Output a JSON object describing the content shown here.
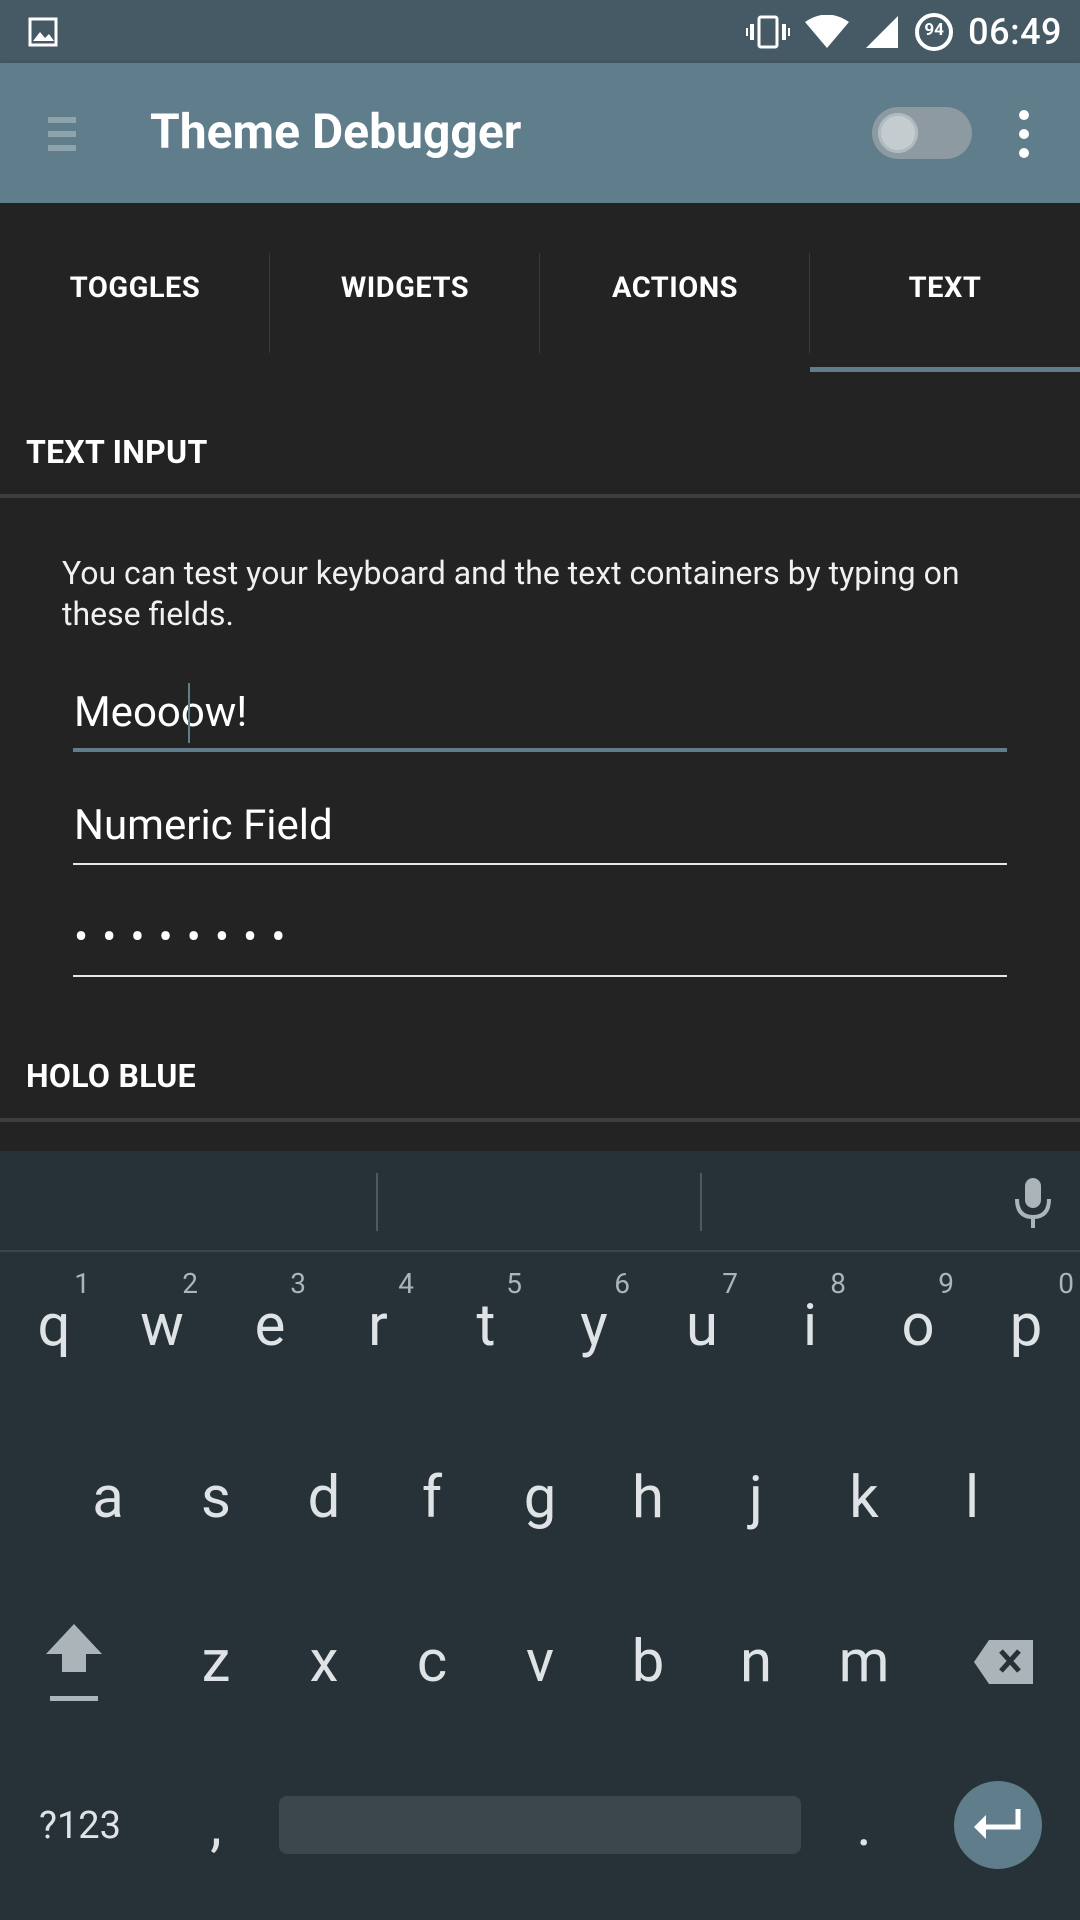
{
  "status_bar": {
    "time": "06:49",
    "battery_level": "94",
    "icons": [
      "image-icon",
      "vibrate-icon",
      "wifi-icon",
      "signal-icon",
      "battery-icon"
    ]
  },
  "app_bar": {
    "title": "Theme Debugger",
    "switch_on": false,
    "background": "#607d8b"
  },
  "tabs": [
    {
      "label": "TOGGLES",
      "selected": false
    },
    {
      "label": "WIDGETS",
      "selected": false
    },
    {
      "label": "ACTIONS",
      "selected": false
    },
    {
      "label": "TEXT",
      "selected": true
    }
  ],
  "content": {
    "text_input": {
      "header": "TEXT INPUT",
      "description": "You can test your keyboard and the text containers by typing on these fields.",
      "fields": [
        {
          "value": "Meooow!",
          "focused": true
        },
        {
          "value": "Numeric Field",
          "focused": false
        },
        {
          "value": "••••••••",
          "focused": false
        }
      ]
    },
    "holo_blue_header": "HOLO BLUE"
  },
  "keyboard": {
    "row1": [
      {
        "key": "q",
        "hint": "1"
      },
      {
        "key": "w",
        "hint": "2"
      },
      {
        "key": "e",
        "hint": "3"
      },
      {
        "key": "r",
        "hint": "4"
      },
      {
        "key": "t",
        "hint": "5"
      },
      {
        "key": "y",
        "hint": "6"
      },
      {
        "key": "u",
        "hint": "7"
      },
      {
        "key": "i",
        "hint": "8"
      },
      {
        "key": "o",
        "hint": "9"
      },
      {
        "key": "p",
        "hint": "0"
      }
    ],
    "row2": [
      "a",
      "s",
      "d",
      "f",
      "g",
      "h",
      "j",
      "k",
      "l"
    ],
    "row3": [
      "z",
      "x",
      "c",
      "v",
      "b",
      "n",
      "m"
    ],
    "symbols_label": "?123",
    "comma": ",",
    "period": "."
  }
}
